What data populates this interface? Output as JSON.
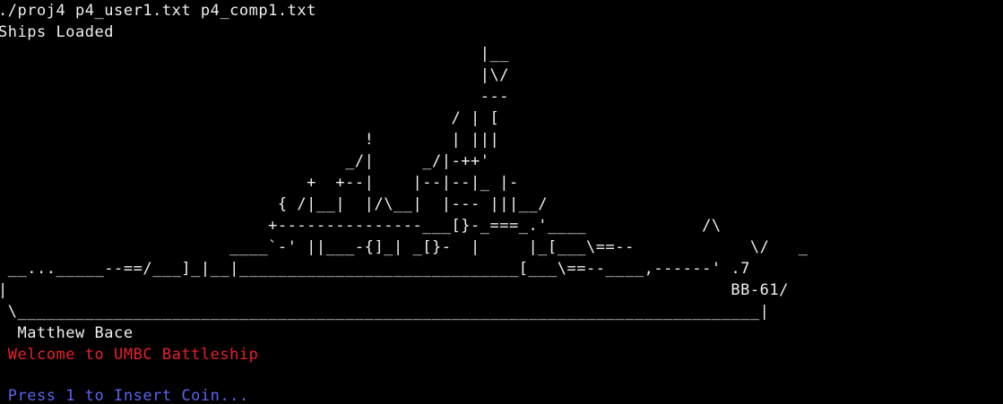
{
  "colors": {
    "background": "#000000",
    "foreground": "#f0f0f0",
    "welcome_red": "#e8202a",
    "prompt_blue": "#5d64f0"
  },
  "terminal": {
    "command_line": "./proj4 p4_user1.txt p4_comp1.txt",
    "status_line": "Ships Loaded",
    "ascii_art": [
      "                                                  |__",
      "                                                  |\\/",
      "                                                  ---",
      "                                               / | [",
      "                                      !        | |||",
      "                                    _/|     _/|-++'",
      "                                +  +--|    |--|--|_ |-",
      "                             { /|__|  |/\\__|  |--- |||__/",
      "                            +---------------___[}-_===_.'____            /\\",
      "                        ____`-' ||___-{]_| _[}-  |     |_[___\\==--            \\/   _",
      " __..._____--==/___]_|__|_____________________________[___\\==--____,------' .7",
      "|                                                                           BB-61/",
      " \\_____________________________________________________________________________|",
      "  Matthew Bace"
    ],
    "welcome": " Welcome to UMBC Battleship",
    "blank": "",
    "prompt": " Press 1 to Insert Coin..."
  }
}
